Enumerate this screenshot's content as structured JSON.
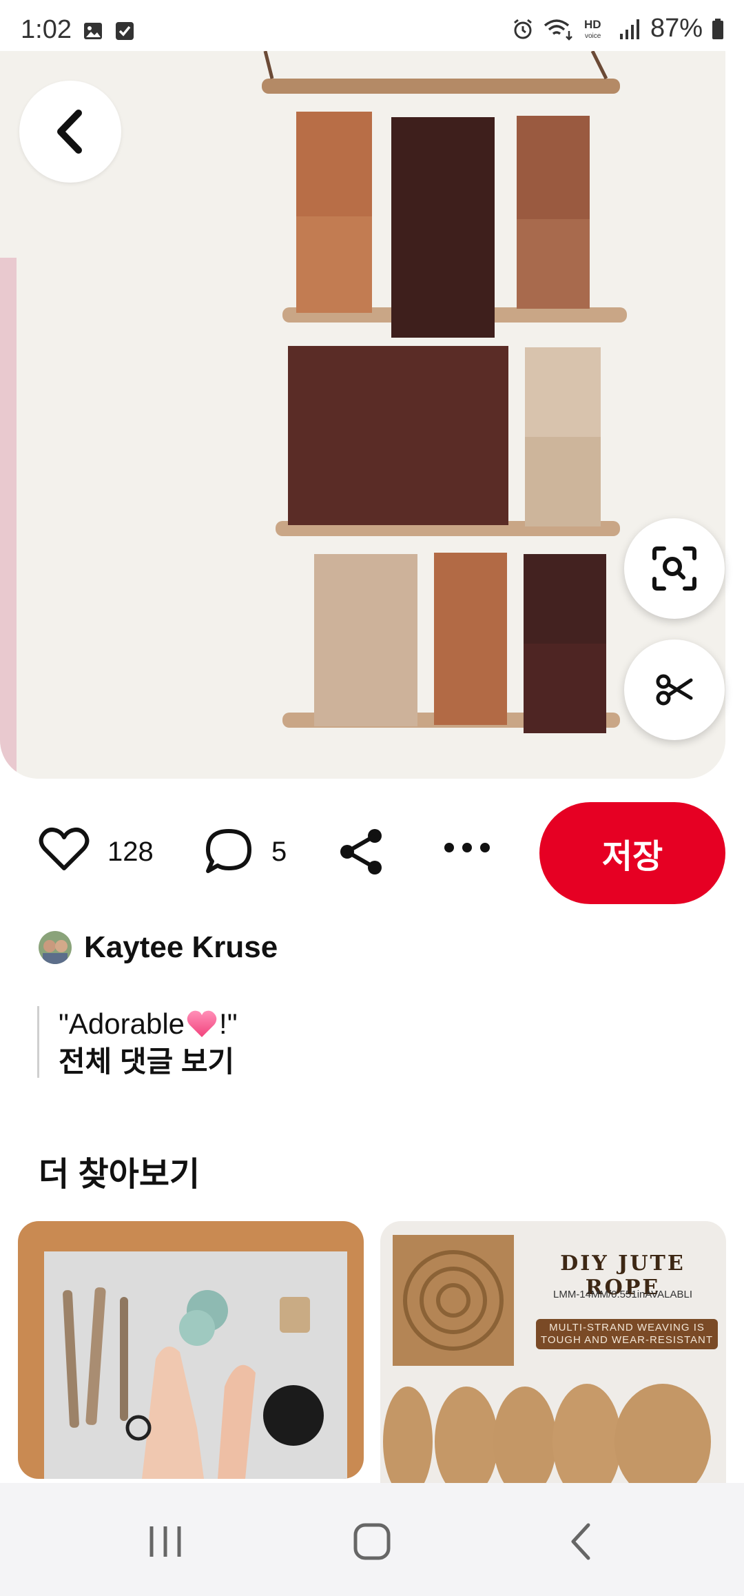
{
  "status_bar": {
    "time": "1:02",
    "battery": "87%",
    "icons": [
      "image-icon",
      "checkbox-icon",
      "alarm-icon",
      "wifi-icon",
      "hd-voice-icon",
      "signal-icon",
      "battery-icon"
    ]
  },
  "hero": {
    "icons": [
      "back-arrow-icon",
      "visual-search-icon",
      "scissors-icon"
    ]
  },
  "actions": {
    "like_count": "128",
    "comment_count": "5",
    "save_label": "저장",
    "icons": [
      "heart-icon",
      "comment-icon",
      "share-icon",
      "more-icon"
    ]
  },
  "author": {
    "name": "Kaytee Kruse"
  },
  "comment": {
    "text_before": "\"Adorable",
    "text_after": "!\"",
    "see_all": "전체 댓글 보기"
  },
  "explore": {
    "title": "더 찾아보기",
    "cards": [
      {
        "id": "card-branches-craft"
      },
      {
        "id": "card-jute-rope",
        "headline": "DIY JUTE ROPE",
        "subline": "LMM-14MM/0.551inAVALABLI",
        "badge_line1": "MULTI-STRAND WEAVING IS",
        "badge_line2": "TOUGH AND WEAR-RESISTANT"
      }
    ]
  },
  "colors": {
    "brand_red": "#e60023",
    "nav_bg": "#f4f4f6"
  },
  "navbar": {
    "icons": [
      "recents-icon",
      "home-icon",
      "back-icon"
    ]
  }
}
